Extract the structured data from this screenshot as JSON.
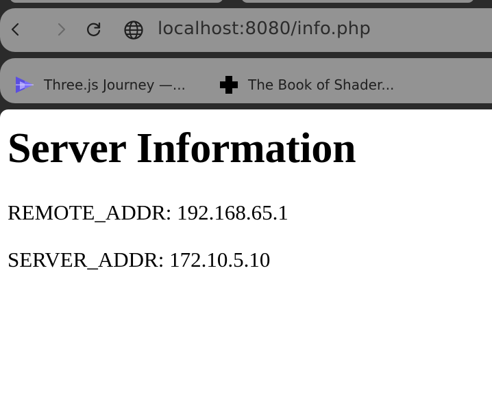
{
  "browser": {
    "url": "localhost:8080/info.php",
    "nav": {
      "back_icon": "chevron-left-icon",
      "forward_icon": "chevron-right-icon",
      "reload_icon": "reload-icon",
      "site_icon": "globe-icon"
    },
    "bookmarks": [
      {
        "label": "Three.js Journey —...",
        "icon": "threejs-journey-icon",
        "color": "#6d5ef5"
      },
      {
        "label": "The Book of Shader...",
        "icon": "plus-cross-icon",
        "color": "#000000"
      }
    ]
  },
  "page": {
    "title": "Server Information",
    "lines": [
      {
        "key": "REMOTE_ADDR",
        "value": "192.168.65.1",
        "text": "REMOTE_ADDR: 192.168.65.1"
      },
      {
        "key": "SERVER_ADDR",
        "value": "172.10.5.10",
        "text": "SERVER_ADDR: 172.10.5.10"
      }
    ]
  },
  "colors": {
    "chrome_bg": "#2b2b2b",
    "bar_bg": "#939393",
    "page_bg": "#ffffff"
  }
}
